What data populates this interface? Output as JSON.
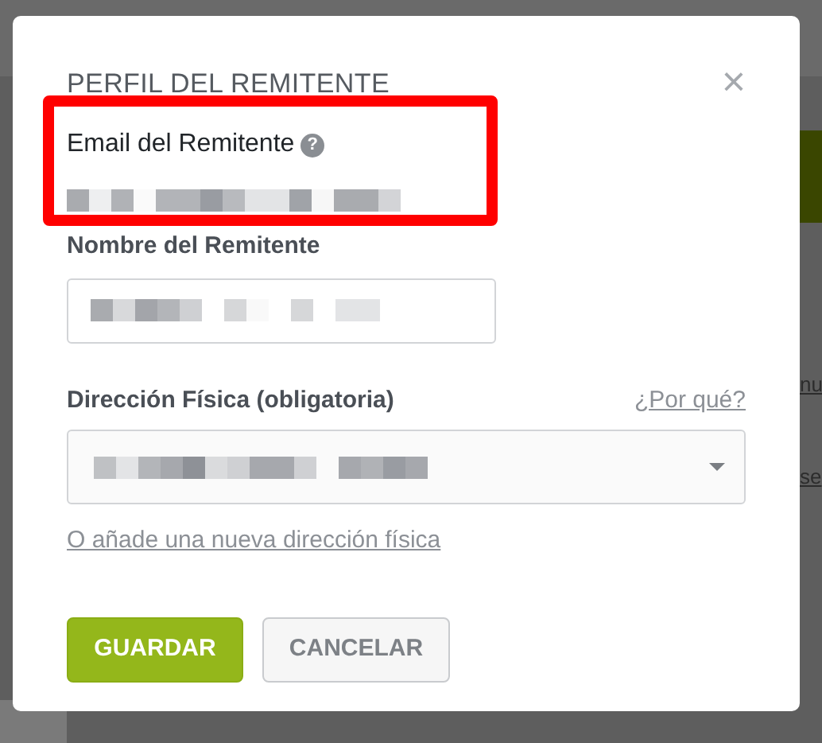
{
  "background": {
    "fragments": [
      "nu",
      "se"
    ]
  },
  "modal": {
    "title": "PERFIL DEL REMITENTE",
    "close": "×",
    "fields": [
      {
        "kind": "static",
        "label": "Email del Remitente",
        "help": "?",
        "highlighted": true
      },
      {
        "kind": "input",
        "label": "Nombre del Remitente"
      },
      {
        "kind": "select",
        "label": "Dirección Física (obligatoria)",
        "aside_link": "¿Por qué?",
        "link": "O añade una nueva dirección física"
      }
    ],
    "buttons": [
      {
        "label": "GUARDAR",
        "kind": "primary"
      },
      {
        "label": "CANCELAR",
        "kind": "secondary"
      }
    ]
  }
}
